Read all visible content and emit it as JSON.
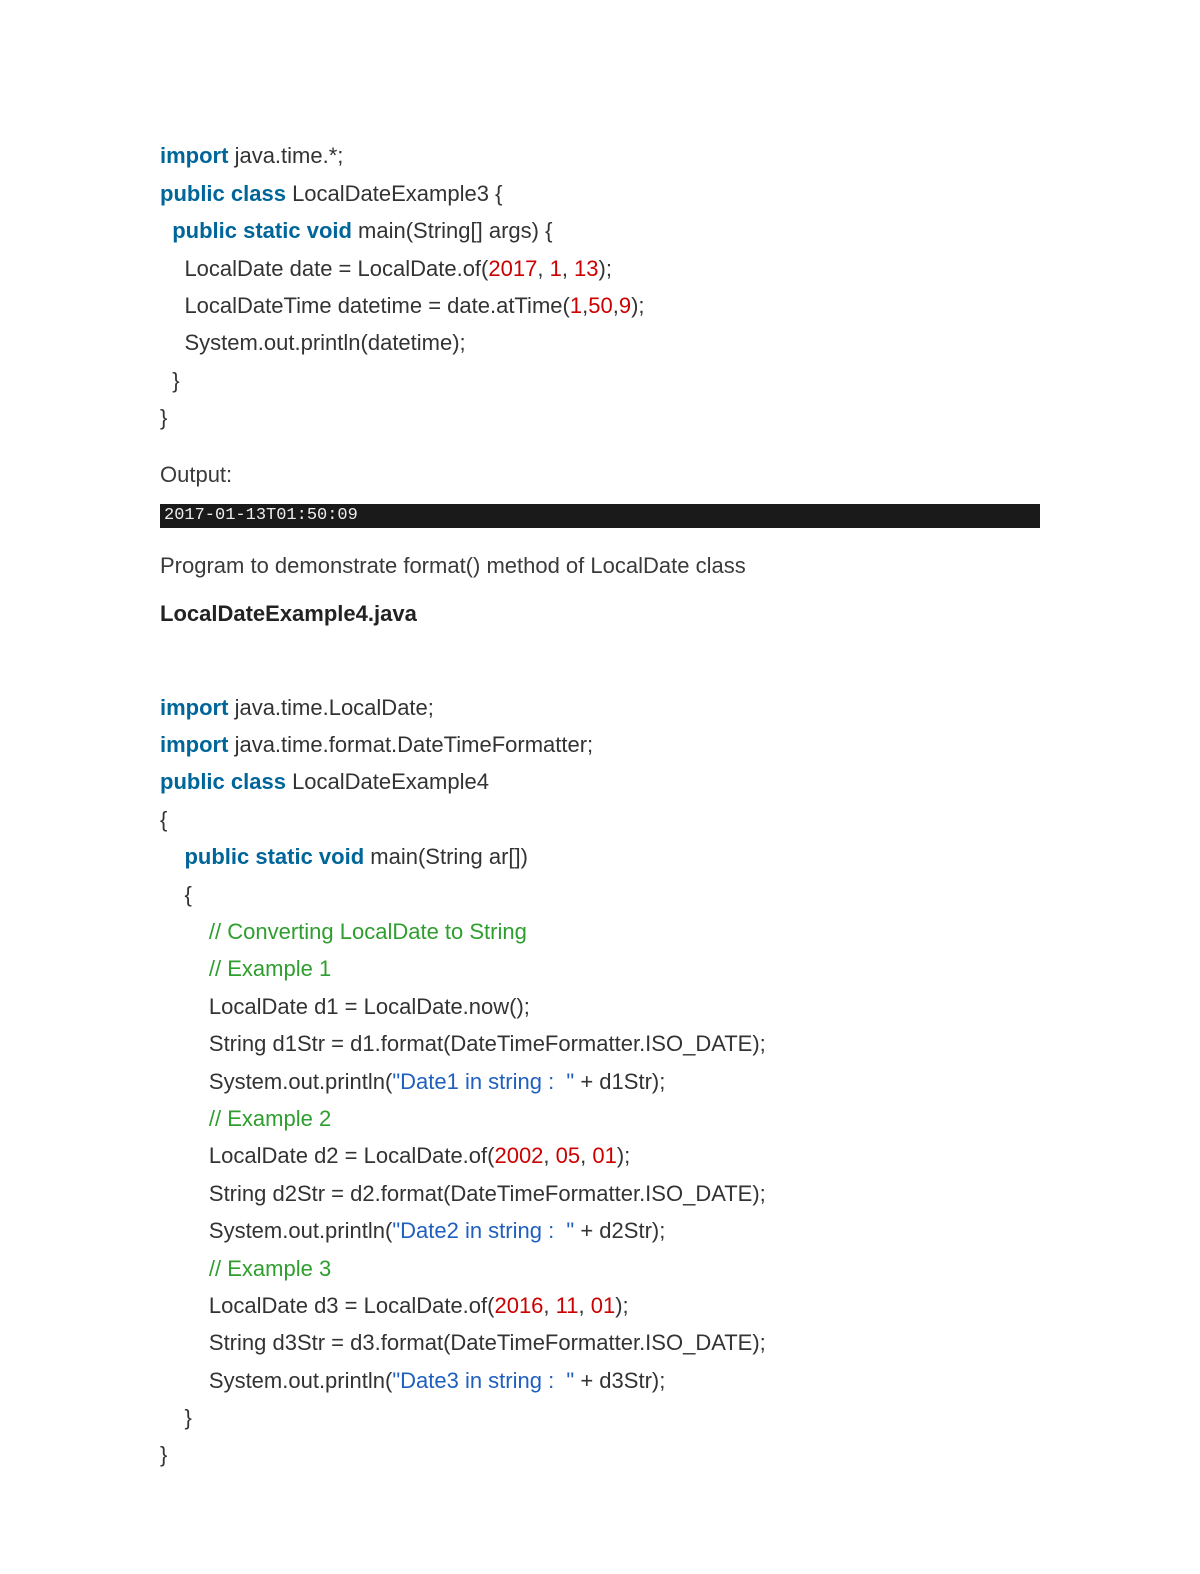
{
  "code1": {
    "l1": {
      "kw": "import",
      "rest": " java.time.*;  "
    },
    "l2": {
      "kw": "public class",
      "rest": " LocalDateExample3 {  "
    },
    "l3": {
      "kw": "public static void",
      "rest": " main(String[] args) {    "
    },
    "l4a": "    LocalDate date = LocalDate.of(",
    "l4n1": "2017",
    "l4c1": ", ",
    "l4n2": "1",
    "l4c2": ", ",
    "l4n3": "13",
    "l4end": ");    ",
    "l5a": "    LocalDateTime datetime = date.atTime(",
    "l5n1": "1",
    "l5c1": ",",
    "l5n2": "50",
    "l5c2": ",",
    "l5n3": "9",
    "l5end": ");    ",
    "l6": "    System.out.println(datetime);      ",
    "l7": "  }    ",
    "l8": "}    "
  },
  "outputLabel": "Output:",
  "consoleOut": "2017-01-13T01:50:09",
  "desc": "Program to demonstrate format() method of LocalDate class",
  "filename": "LocalDateExample4.java",
  "code2": {
    "l1": {
      "kw": "import",
      "rest": " java.time.LocalDate;  "
    },
    "l2": {
      "kw": "import",
      "rest": " java.time.format.DateTimeFormatter;  "
    },
    "l3": {
      "kw": "public class",
      "rest": " LocalDateExample4  "
    },
    "l4": "{  ",
    "l5": {
      "kw": "public static void",
      "rest": " main(String ar[])  "
    },
    "l6": "    {  ",
    "l7cmt": "        // Converting LocalDate to String  ",
    "l8cmt": "        // Example 1  ",
    "l9": "        LocalDate d1 = LocalDate.now();  ",
    "l10": "        String d1Str = d1.format(DateTimeFormatter.ISO_DATE);  ",
    "l11a": "        System.out.println(",
    "l11s": "\"Date1 in string :  \"",
    "l11b": " + d1Str);  ",
    "l12cmt": "        // Example 2  ",
    "l13a": "        LocalDate d2 = LocalDate.of(",
    "l13n1": "2002",
    "l13c1": ", ",
    "l13n2": "05",
    "l13c2": ", ",
    "l13n3": "01",
    "l13end": ");  ",
    "l14": "        String d2Str = d2.format(DateTimeFormatter.ISO_DATE);  ",
    "l15a": "        System.out.println(",
    "l15s": "\"Date2 in string :  \"",
    "l15b": " + d2Str);  ",
    "l16cmt": "        // Example 3  ",
    "l17a": "        LocalDate d3 = LocalDate.of(",
    "l17n1": "2016",
    "l17c1": ", ",
    "l17n2": "11",
    "l17c2": ", ",
    "l17n3": "01",
    "l17end": ");  ",
    "l18": "        String d3Str = d3.format(DateTimeFormatter.ISO_DATE);  ",
    "l19a": "        System.out.println(",
    "l19s": "\"Date3 in string :  \"",
    "l19b": " + d3Str);  ",
    "l20": "    }  ",
    "l21": "}  "
  }
}
